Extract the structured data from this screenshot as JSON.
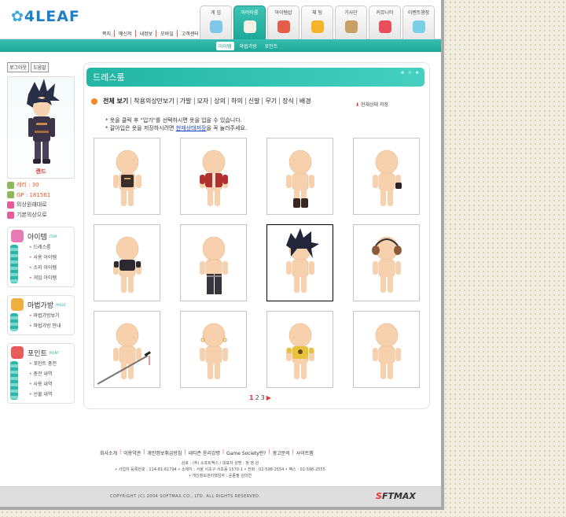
{
  "logo": {
    "text": "4LEAF"
  },
  "util_links": [
    "쪽지",
    "메신저",
    "내정보",
    "모바일",
    "고객센터"
  ],
  "main_nav": [
    {
      "label": "게 임",
      "icon": "game-icon",
      "color": "#7fc7e8"
    },
    {
      "label": "아바타룸",
      "icon": "avatar-icon",
      "color": "#f4f0e4",
      "active": true
    },
    {
      "label": "아이템샵",
      "icon": "shop-icon",
      "color": "#e85c4a"
    },
    {
      "label": "채 팅",
      "icon": "chat-icon",
      "color": "#f5b52a"
    },
    {
      "label": "기사단",
      "icon": "knight-icon",
      "color": "#c9a064"
    },
    {
      "label": "커뮤니티",
      "icon": "community-icon",
      "color": "#e84f5b"
    },
    {
      "label": "이벤트광장",
      "icon": "event-icon",
      "color": "#7ad0e6"
    }
  ],
  "sub_nav": [
    {
      "label": "아이템",
      "active": true
    },
    {
      "label": "마법가방",
      "active": false
    },
    {
      "label": "포인트",
      "active": false
    }
  ],
  "sidebar": {
    "logout": "로그아웃",
    "help": "도움말",
    "character_name": "캔드",
    "stats": [
      {
        "label": "레리 : 30",
        "icon": "level-icon",
        "color": "#8fb85a"
      },
      {
        "label": "GP : 181561",
        "icon": "gp-icon",
        "color": "#8fb85a"
      },
      {
        "label": "의상원래대로",
        "icon": "reset-outfit-icon",
        "color": "#e85b9a"
      },
      {
        "label": "기본의상으로",
        "icon": "default-outfit-icon",
        "color": "#e85b9a"
      }
    ],
    "menus": [
      {
        "title": "아이템",
        "tag": "ITEM",
        "icon_color": "#e87bb5",
        "items": [
          "드레스룸",
          "사용 아이템",
          "소지 아이템",
          "게임 아이템"
        ]
      },
      {
        "title": "마법가방",
        "tag": "MAGIC",
        "icon_color": "#f0b040",
        "items": [
          "마법가방보기",
          "마법가방 안내"
        ]
      },
      {
        "title": "포인트",
        "tag": "POINT",
        "icon_color": "#e85b5b",
        "items": [
          "포인트 충전",
          "충전 내역",
          "사용 내역",
          "선물 내역"
        ]
      }
    ]
  },
  "content": {
    "title": "드레스룸",
    "filters": [
      "전체 보기",
      "착용의상만보기",
      "가발",
      "모자",
      "상의",
      "하의",
      "신발",
      "무기",
      "장식",
      "배경"
    ],
    "save_label": "현재상태 저장",
    "note1": "* 옷을 클릭 후 \"입기\"를 선택하시면 옷을 입을 수 있습니다.",
    "note2_pre": "* 갈아입은 옷을 저장하시려면 ",
    "note2_link": "현재상태저장",
    "note2_post": "을 꼭 눌러주세요."
  },
  "items": [
    {
      "type": "vest",
      "selected": false
    },
    {
      "type": "red-jacket",
      "selected": false
    },
    {
      "type": "boots",
      "selected": false
    },
    {
      "type": "glove",
      "selected": false
    },
    {
      "type": "dark-shirt",
      "selected": false
    },
    {
      "type": "pants",
      "selected": false
    },
    {
      "type": "spiky-hair",
      "selected": true
    },
    {
      "type": "ear-muff",
      "selected": false
    },
    {
      "type": "sword",
      "selected": false
    },
    {
      "type": "earrings",
      "selected": false
    },
    {
      "type": "yellow-shirt",
      "selected": false
    },
    {
      "type": "bare",
      "selected": false
    }
  ],
  "pagination": {
    "pages": [
      "1",
      "2",
      "3"
    ],
    "current": "1",
    "next": "▶"
  },
  "footer": {
    "links": [
      "회사소개",
      "이용약관",
      "개인정보취급방침",
      "네티즌 윤리강령",
      "Game Society란?",
      "광고문의",
      "사이트맵"
    ],
    "info1": "상호 : (주) 소프트맥스 / 대표자 성명 : 정 영 원",
    "info2": "• 사업자 등록번호 : 114-81-61794 • 소재지 : 서울 서초구 서초동 1570-1 • 전화 : 02-598-2554 • 팩스 : 02-598-2555",
    "info3": "• 개인정보관리책임자 : 윤종필 김미연",
    "copyright": "COPYRIGHT (C) 2004 SOFTMAX.CO., LTD. ALL RIGHTS RESERVED.",
    "brand_s": "S",
    "brand_rest": "FTMAX"
  }
}
